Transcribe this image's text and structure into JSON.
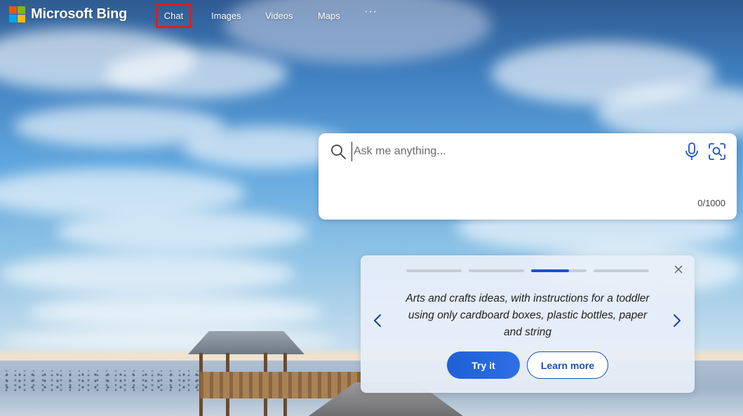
{
  "header": {
    "brand": "Microsoft Bing",
    "nav": {
      "chat": "Chat",
      "images": "Images",
      "videos": "Videos",
      "maps": "Maps",
      "more": "···"
    }
  },
  "search": {
    "placeholder": "Ask me anything...",
    "value": "",
    "counter": "0/1000"
  },
  "suggestion_card": {
    "prompt": "Arts and crafts ideas, with instructions for a toddler using only cardboard boxes, plastic bottles, paper and string",
    "try_label": "Try it",
    "learn_label": "Learn more",
    "carousel": {
      "total": 4,
      "active_index": 2,
      "active_progress": 0.68
    }
  },
  "colors": {
    "accent": "#1a53c9",
    "highlight_box": "#e21b1b"
  },
  "icons": {
    "search": "search-icon",
    "mic": "microphone-icon",
    "visual_search": "visual-search-icon",
    "close": "close-icon",
    "prev": "chevron-left-icon",
    "next": "chevron-right-icon"
  }
}
